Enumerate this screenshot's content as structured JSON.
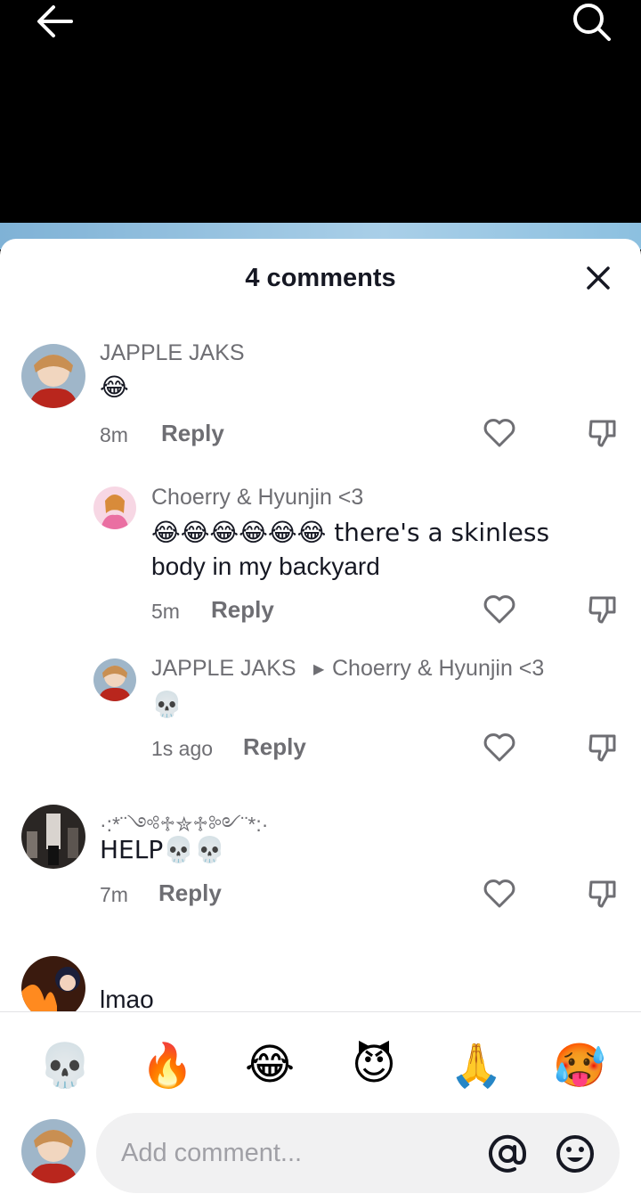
{
  "header": {
    "title": "4 comments"
  },
  "comments": [
    {
      "username": "JAPPLE JAKS",
      "text": "😂",
      "time": "8m",
      "reply_label": "Reply"
    },
    {
      "username": "Choerry & Hyunjin <3",
      "text_line1": "😂😂😂😂😂😂 there's a skinless",
      "text_line2": "body in my backyard",
      "time": "5m",
      "reply_label": "Reply"
    },
    {
      "username": "JAPPLE JAKS",
      "reply_to": "Choerry & Hyunjin <3",
      "text": "💀",
      "time": "1s ago",
      "reply_label": "Reply"
    },
    {
      "username": "·:*¨༺♱✮♱༻¨*:·",
      "text": "HELP💀💀",
      "time": "7m",
      "reply_label": "Reply"
    },
    {
      "text": "lmao"
    }
  ],
  "quick_emojis": [
    "💀",
    "🔥",
    "😂",
    "😈",
    "🙏",
    "🥵"
  ],
  "composer": {
    "placeholder": "Add comment..."
  },
  "icons": {
    "back": "arrow-left-icon",
    "search": "search-icon",
    "close": "close-icon",
    "like": "heart-icon",
    "dislike": "thumbs-down-icon",
    "mention": "at-icon",
    "emoji": "smiley-icon"
  }
}
